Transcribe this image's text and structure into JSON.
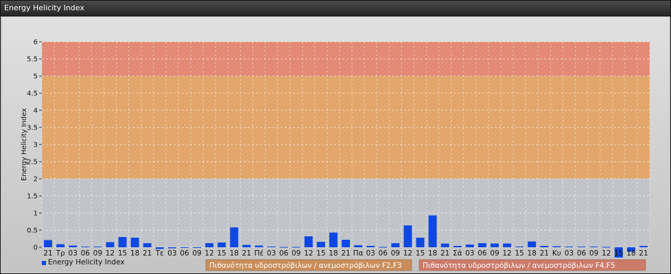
{
  "window": {
    "title": "Energy Helicity Index"
  },
  "chart_data": {
    "type": "bar",
    "ylabel": "Energy Helicity Index",
    "ylim": [
      0,
      6
    ],
    "yticks": [
      "0",
      "0.5",
      "1",
      "1.5",
      "2",
      "2.5",
      "3",
      "3.5",
      "4",
      "4.5",
      "5",
      "5.5",
      "6"
    ],
    "grid": true,
    "bands": [
      {
        "from": 0,
        "to": 2,
        "color": "#bfc3c9"
      },
      {
        "from": 2,
        "to": 5,
        "color": "#e2a468"
      },
      {
        "from": 5,
        "to": 6,
        "color": "#e28873"
      }
    ],
    "categories": [
      "21",
      "Τρ",
      "03",
      "06",
      "09",
      "12",
      "15",
      "18",
      "21",
      "Τε",
      "03",
      "06",
      "09",
      "12",
      "15",
      "18",
      "21",
      "Πέ",
      "03",
      "06",
      "09",
      "12",
      "15",
      "18",
      "21",
      "Πα",
      "03",
      "06",
      "09",
      "12",
      "15",
      "18",
      "21",
      "Σά",
      "03",
      "06",
      "09",
      "12",
      "15",
      "18",
      "21",
      "Κυ",
      "03",
      "06",
      "09",
      "12",
      "15",
      "18",
      "21"
    ],
    "series": [
      {
        "name": "Energy Helicity Index",
        "color": "#0f48e0",
        "values": [
          0.21,
          0.09,
          0.05,
          0.02,
          0.02,
          0.15,
          0.3,
          0.28,
          0.12,
          -0.05,
          -0.03,
          -0.02,
          -0.02,
          0.12,
          0.14,
          0.58,
          0.07,
          0.05,
          0.02,
          0.01,
          0.01,
          0.32,
          0.16,
          0.43,
          0.22,
          0.06,
          0.04,
          0.01,
          0.12,
          0.64,
          0.28,
          0.93,
          0.11,
          0.04,
          0.08,
          0.12,
          0.11,
          0.11,
          0.02,
          0.17,
          0.04,
          0.03,
          0.02,
          0.02,
          0.02,
          0.01,
          -0.3,
          -0.13,
          0.04
        ]
      }
    ],
    "legend": {
      "position": "bottom-left",
      "label": "Energy Helicity Index",
      "bands": [
        {
          "label": "Πιθανότητα υδροστρόβιλων / ανεμοστρόβιλων F2,F3",
          "color": "#c98d5b"
        },
        {
          "label": "Πιθανότητα υδροστρόβιλων / ανεμοστρόβιλων F4,F5",
          "color": "#cc7a6a"
        }
      ]
    }
  }
}
